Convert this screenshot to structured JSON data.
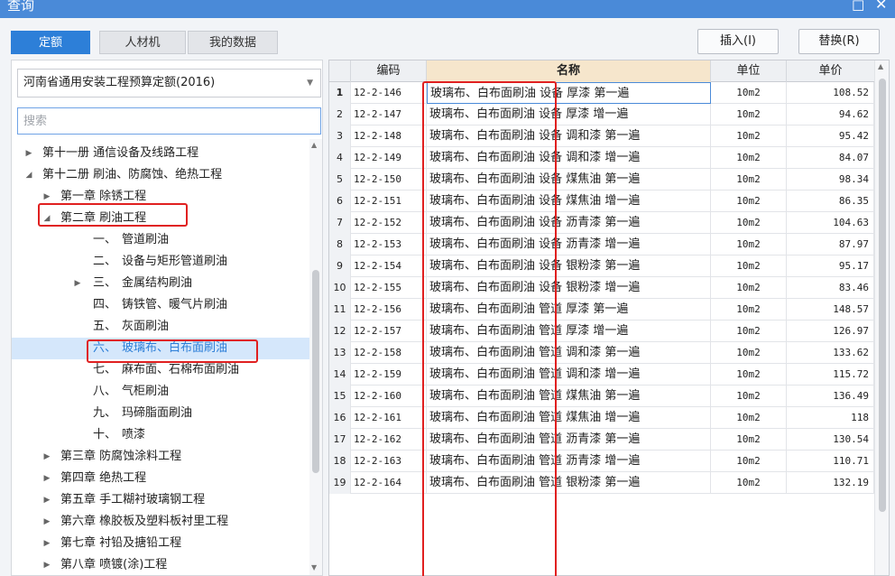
{
  "window": {
    "title": "查询",
    "minimize_icon": "minimize-icon",
    "close_icon": "close-icon",
    "minimize_glyph": "□",
    "close_glyph": "✕"
  },
  "tabs": [
    {
      "label": "定额",
      "active": true
    },
    {
      "label": "人材机",
      "active": false
    },
    {
      "label": "我的数据",
      "active": false
    }
  ],
  "buttons": {
    "insert": "插入(I)",
    "replace": "替换(R)"
  },
  "quota_library": {
    "selected": "河南省通用安装工程预算定额(2016)"
  },
  "search": {
    "placeholder": "搜索",
    "value": ""
  },
  "tree": [
    {
      "label": "第十一册 通信设备及线路工程",
      "expanded": false,
      "has_children": true,
      "level": 0
    },
    {
      "label": "第十二册 刷油、防腐蚀、绝热工程",
      "expanded": true,
      "has_children": true,
      "level": 0
    },
    {
      "label": "第一章 除锈工程",
      "expanded": false,
      "has_children": true,
      "level": 1
    },
    {
      "label": "第二章 刷油工程",
      "expanded": true,
      "has_children": true,
      "level": 1
    },
    {
      "num": "一、",
      "name": "管道刷油",
      "level": 2
    },
    {
      "num": "二、",
      "name": "设备与矩形管道刷油",
      "level": 2
    },
    {
      "num": "三、",
      "name": "金属结构刷油",
      "level": 2,
      "has_children": true,
      "expanded": false
    },
    {
      "num": "四、",
      "name": "铸铁管、暖气片刷油",
      "level": 2
    },
    {
      "num": "五、",
      "name": "灰面刷油",
      "level": 2
    },
    {
      "num": "六、",
      "name": "玻璃布、白布面刷油",
      "level": 2,
      "selected": true
    },
    {
      "num": "七、",
      "name": "麻布面、石棉布面刷油",
      "level": 2
    },
    {
      "num": "八、",
      "name": "气柜刷油",
      "level": 2
    },
    {
      "num": "九、",
      "name": "玛碲脂面刷油",
      "level": 2
    },
    {
      "num": "十、",
      "name": "喷漆",
      "level": 2
    },
    {
      "label": "第三章 防腐蚀涂料工程",
      "expanded": false,
      "has_children": true,
      "level": 1
    },
    {
      "label": "第四章 绝热工程",
      "expanded": false,
      "has_children": true,
      "level": 1
    },
    {
      "label": "第五章 手工糊衬玻璃钢工程",
      "expanded": false,
      "has_children": true,
      "level": 1
    },
    {
      "label": "第六章 橡胶板及塑料板衬里工程",
      "expanded": false,
      "has_children": true,
      "level": 1
    },
    {
      "label": "第七章 衬铅及搪铅工程",
      "expanded": false,
      "has_children": true,
      "level": 1
    },
    {
      "label": "第八章 喷镀(涂)工程",
      "expanded": false,
      "has_children": true,
      "level": 1
    }
  ],
  "table": {
    "headers": {
      "code": "编码",
      "name": "名称",
      "unit": "单位",
      "price": "单价"
    },
    "rows": [
      {
        "idx": "1",
        "code": "12-2-146",
        "name": "玻璃布、白布面刷油 设备 厚漆 第一遍",
        "unit": "10m2",
        "price": "108.52"
      },
      {
        "idx": "2",
        "code": "12-2-147",
        "name": "玻璃布、白布面刷油 设备 厚漆 增一遍",
        "unit": "10m2",
        "price": "94.62"
      },
      {
        "idx": "3",
        "code": "12-2-148",
        "name": "玻璃布、白布面刷油 设备 调和漆 第一遍",
        "unit": "10m2",
        "price": "95.42"
      },
      {
        "idx": "4",
        "code": "12-2-149",
        "name": "玻璃布、白布面刷油 设备 调和漆 增一遍",
        "unit": "10m2",
        "price": "84.07"
      },
      {
        "idx": "5",
        "code": "12-2-150",
        "name": "玻璃布、白布面刷油 设备 煤焦油 第一遍",
        "unit": "10m2",
        "price": "98.34"
      },
      {
        "idx": "6",
        "code": "12-2-151",
        "name": "玻璃布、白布面刷油 设备 煤焦油 增一遍",
        "unit": "10m2",
        "price": "86.35"
      },
      {
        "idx": "7",
        "code": "12-2-152",
        "name": "玻璃布、白布面刷油 设备 沥青漆 第一遍",
        "unit": "10m2",
        "price": "104.63"
      },
      {
        "idx": "8",
        "code": "12-2-153",
        "name": "玻璃布、白布面刷油 设备 沥青漆 增一遍",
        "unit": "10m2",
        "price": "87.97"
      },
      {
        "idx": "9",
        "code": "12-2-154",
        "name": "玻璃布、白布面刷油 设备 银粉漆 第一遍",
        "unit": "10m2",
        "price": "95.17"
      },
      {
        "idx": "10",
        "code": "12-2-155",
        "name": "玻璃布、白布面刷油 设备 银粉漆 增一遍",
        "unit": "10m2",
        "price": "83.46"
      },
      {
        "idx": "11",
        "code": "12-2-156",
        "name": "玻璃布、白布面刷油 管道 厚漆 第一遍",
        "unit": "10m2",
        "price": "148.57"
      },
      {
        "idx": "12",
        "code": "12-2-157",
        "name": "玻璃布、白布面刷油 管道 厚漆 增一遍",
        "unit": "10m2",
        "price": "126.97"
      },
      {
        "idx": "13",
        "code": "12-2-158",
        "name": "玻璃布、白布面刷油 管道 调和漆 第一遍",
        "unit": "10m2",
        "price": "133.62"
      },
      {
        "idx": "14",
        "code": "12-2-159",
        "name": "玻璃布、白布面刷油 管道 调和漆 增一遍",
        "unit": "10m2",
        "price": "115.72"
      },
      {
        "idx": "15",
        "code": "12-2-160",
        "name": "玻璃布、白布面刷油 管道 煤焦油 第一遍",
        "unit": "10m2",
        "price": "136.49"
      },
      {
        "idx": "16",
        "code": "12-2-161",
        "name": "玻璃布、白布面刷油 管道 煤焦油 增一遍",
        "unit": "10m2",
        "price": "118"
      },
      {
        "idx": "17",
        "code": "12-2-162",
        "name": "玻璃布、白布面刷油 管道 沥青漆 第一遍",
        "unit": "10m2",
        "price": "130.54"
      },
      {
        "idx": "18",
        "code": "12-2-163",
        "name": "玻璃布、白布面刷油 管道 沥青漆 增一遍",
        "unit": "10m2",
        "price": "110.71"
      },
      {
        "idx": "19",
        "code": "12-2-164",
        "name": "玻璃布、白布面刷油 管道 银粉漆 第一遍",
        "unit": "10m2",
        "price": "132.19"
      }
    ]
  },
  "colors": {
    "accent": "#2d7fd8",
    "title_bar": "#4a8ad8",
    "highlight": "#e02020",
    "header_name_bg": "#f6e6cc",
    "selected_bg": "#d5e7fb"
  }
}
